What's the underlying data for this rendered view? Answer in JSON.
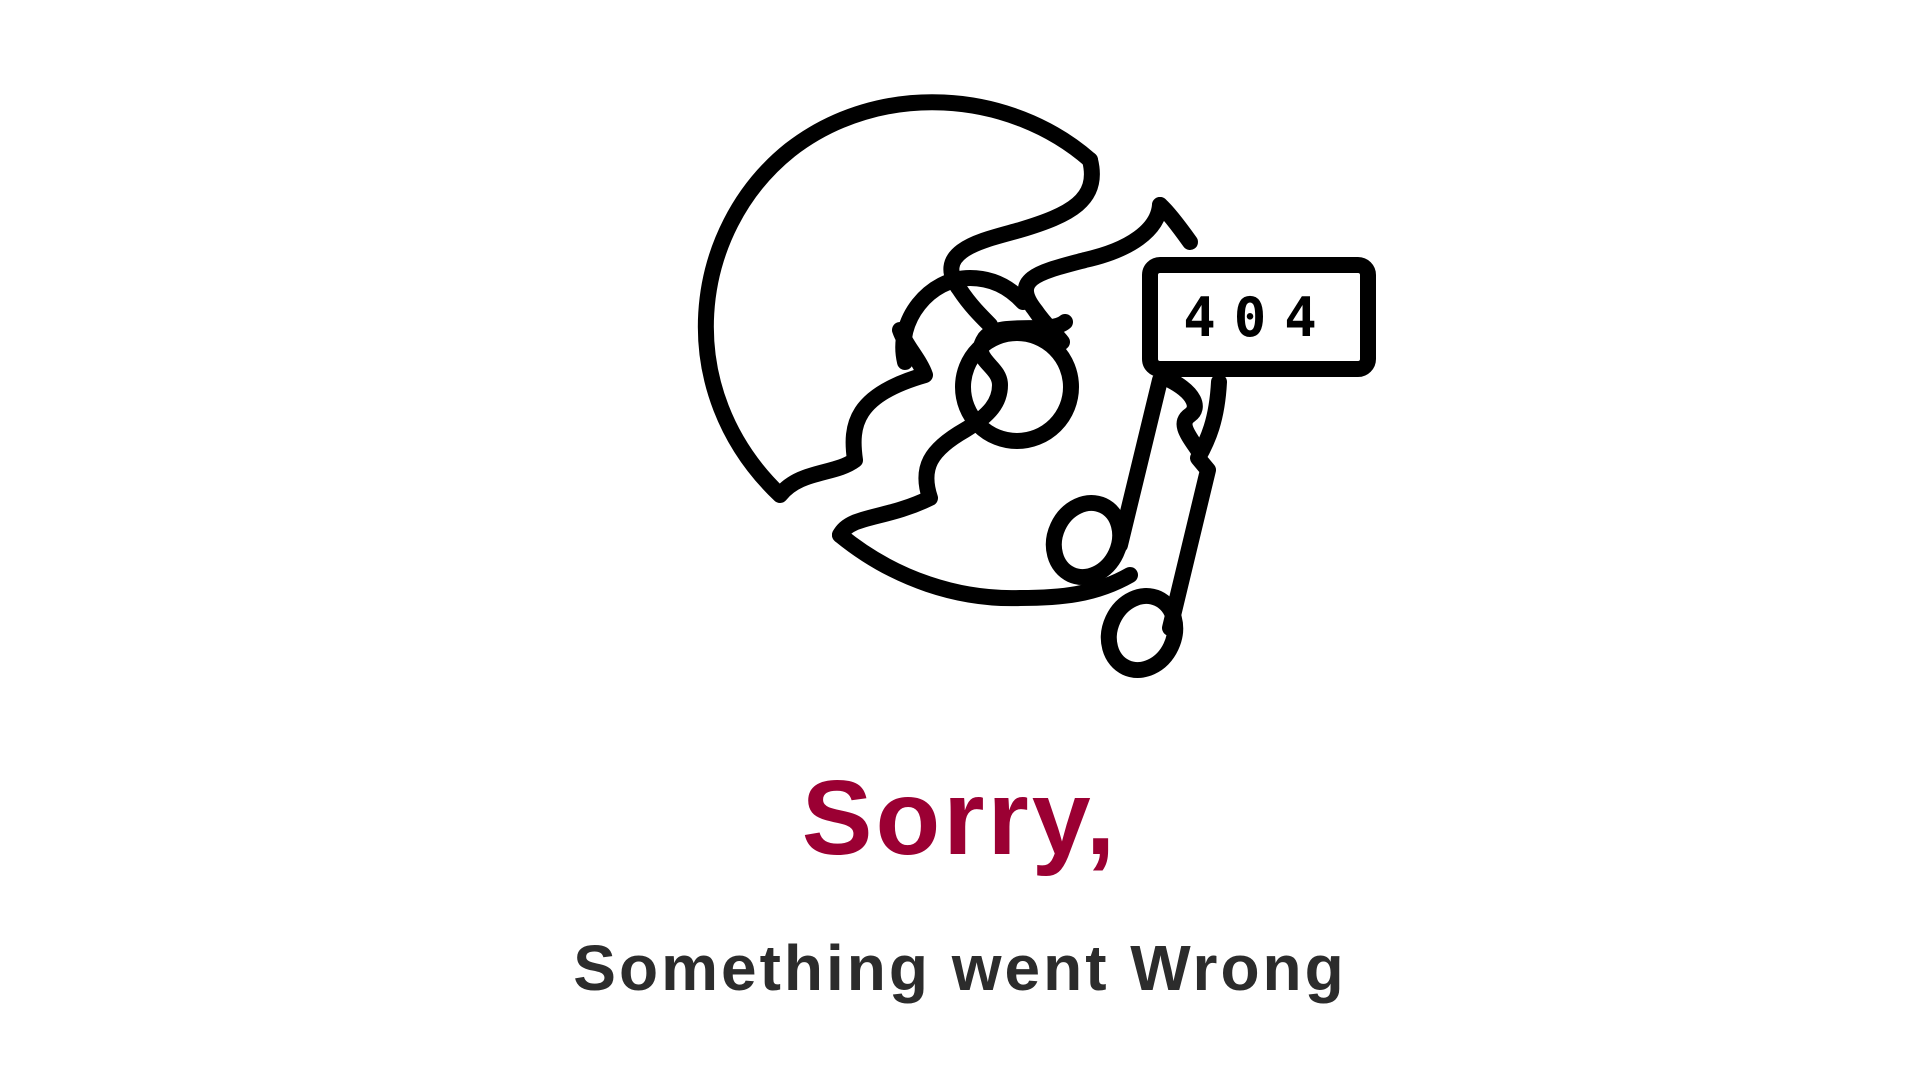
{
  "illustration": {
    "icon": "music-note-404-icon",
    "badge_text": "404",
    "stroke_color": "#000000"
  },
  "message": {
    "headline": "Sorry,",
    "subline": "Something went Wrong"
  },
  "colors": {
    "headline": "#9b0033",
    "subline": "#2c2c2c",
    "background": "#ffffff"
  }
}
